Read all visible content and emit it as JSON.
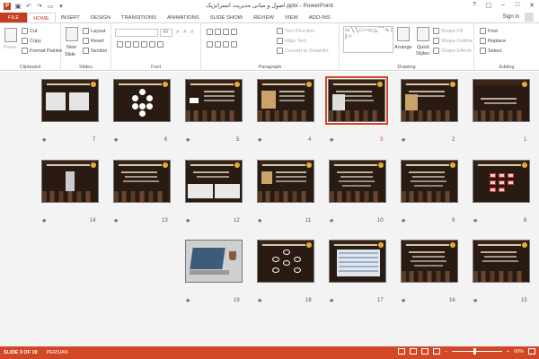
{
  "window": {
    "title": "اصول و مبانی مدیریت استراتژیک.pptx - PowerPoint",
    "controls": [
      "?",
      "▢",
      "–",
      "□",
      "✕"
    ]
  },
  "qat": {
    "icons": [
      "app-icon",
      "save-icon",
      "undo-icon",
      "redo-icon",
      "start-slideshow-icon",
      "customize-icon"
    ]
  },
  "tabs": [
    "FILE",
    "HOME",
    "INSERT",
    "DESIGN",
    "TRANSITIONS",
    "ANIMATIONS",
    "SLIDE SHOW",
    "REVIEW",
    "VIEW",
    "ADD-INS"
  ],
  "active_tab": "HOME",
  "account": {
    "signin": "Sign in"
  },
  "ribbon": {
    "clipboard": {
      "label": "Clipboard",
      "paste": "Paste",
      "cut": "Cut",
      "copy": "Copy",
      "format_painter": "Format Painter"
    },
    "slides": {
      "label": "Slides",
      "new_slide": "New",
      "new_slide2": "Slide",
      "layout": "Layout",
      "reset": "Reset",
      "section": "Section"
    },
    "font": {
      "label": "Font",
      "font_size": "40",
      "grow": "A",
      "shrink": "A",
      "clear": "A"
    },
    "paragraph": {
      "label": "Paragraph",
      "text_direction": "Text Direction",
      "align_text": "Align Text",
      "convert_smartart": "Convert to SmartArt"
    },
    "drawing": {
      "label": "Drawing",
      "arrange": "Arrange",
      "quick_styles": "Quick",
      "quick_styles2": "Styles",
      "shape_fill": "Shape Fill",
      "shape_outline": "Shape Outline",
      "shape_effects": "Shape Effects",
      "shapes_glyphs": "▭╲╲□○▭△⌒∿▢◻▷↗⇦⇨{ }☆"
    },
    "editing": {
      "label": "Editing",
      "find": "Find",
      "replace": "Replace",
      "select": "Select"
    }
  },
  "slides": [
    {
      "num": "1",
      "star": ""
    },
    {
      "num": "2",
      "star": "★"
    },
    {
      "num": "3",
      "star": "★",
      "selected": true
    },
    {
      "num": "4",
      "star": "★"
    },
    {
      "num": "5",
      "star": "★"
    },
    {
      "num": "6",
      "star": "★"
    },
    {
      "num": "7",
      "star": "★"
    },
    {
      "num": "8",
      "star": "★"
    },
    {
      "num": "9",
      "star": "★"
    },
    {
      "num": "10",
      "star": "★"
    },
    {
      "num": "11",
      "star": "★"
    },
    {
      "num": "12",
      "star": "★"
    },
    {
      "num": "13",
      "star": "★"
    },
    {
      "num": "14",
      "star": "★"
    },
    {
      "num": "15",
      "star": "★"
    },
    {
      "num": "16",
      "star": "★"
    },
    {
      "num": "17",
      "star": "★"
    },
    {
      "num": "18",
      "star": "★"
    },
    {
      "num": "19",
      "star": "★"
    }
  ],
  "status": {
    "slide_info": "SLIDE 3 OF 19",
    "language": "PERSIAN",
    "zoom": "60%"
  },
  "colors": {
    "accent": "#d24726",
    "file_tab": "#c43e1c"
  }
}
